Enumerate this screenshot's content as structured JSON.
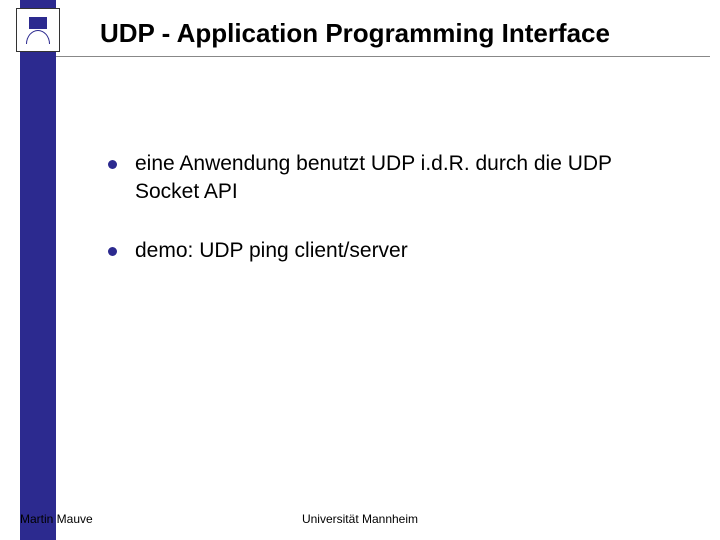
{
  "title": "UDP - Application Programming Interface",
  "bullets": [
    {
      "text": "eine Anwendung benutzt UDP i.d.R. durch die UDP Socket API"
    },
    {
      "text": "demo: UDP ping client/server"
    }
  ],
  "footer": {
    "author": "Martin Mauve",
    "institution": "Universität Mannheim"
  },
  "colors": {
    "accent": "#2c2a8f"
  }
}
